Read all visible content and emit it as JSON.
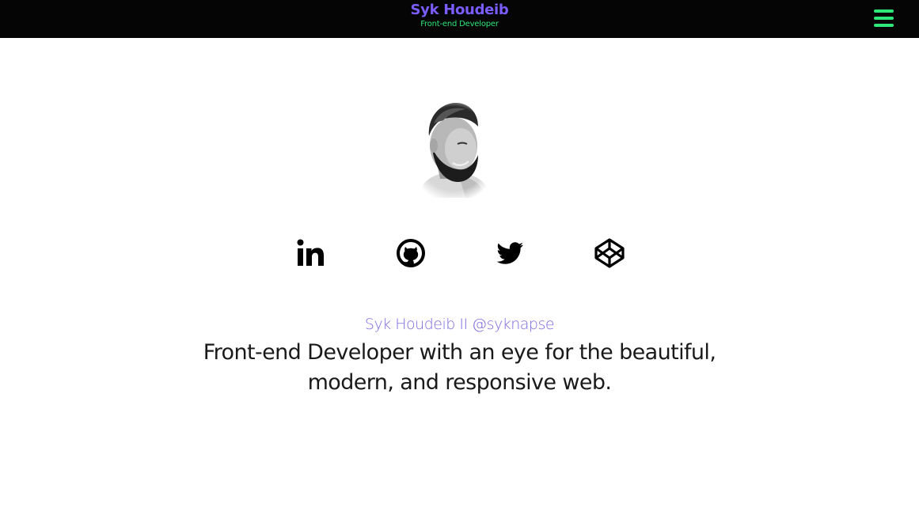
{
  "header": {
    "name": "Syk Houdeib",
    "subtitle": "Front-end Developer",
    "menu_icon": "hamburger-menu-icon"
  },
  "profile": {
    "avatar_icon": "profile-photo"
  },
  "social_links": [
    {
      "name": "LinkedIn",
      "icon": "linkedin-icon"
    },
    {
      "name": "GitHub",
      "icon": "github-icon"
    },
    {
      "name": "Twitter",
      "icon": "twitter-icon"
    },
    {
      "name": "CodePen",
      "icon": "codepen-icon"
    }
  ],
  "intro": {
    "handle": "Syk Houdeib II @syknapse",
    "tagline": "Front-end Developer with an eye for the beautiful, modern, and responsive web."
  },
  "colors": {
    "header_bg": "#050505",
    "brand_name": "#7b5cff",
    "accent_green": "#2ee87a",
    "handle_purple": "#7b6be0",
    "text_dark": "#1a1a1a"
  }
}
